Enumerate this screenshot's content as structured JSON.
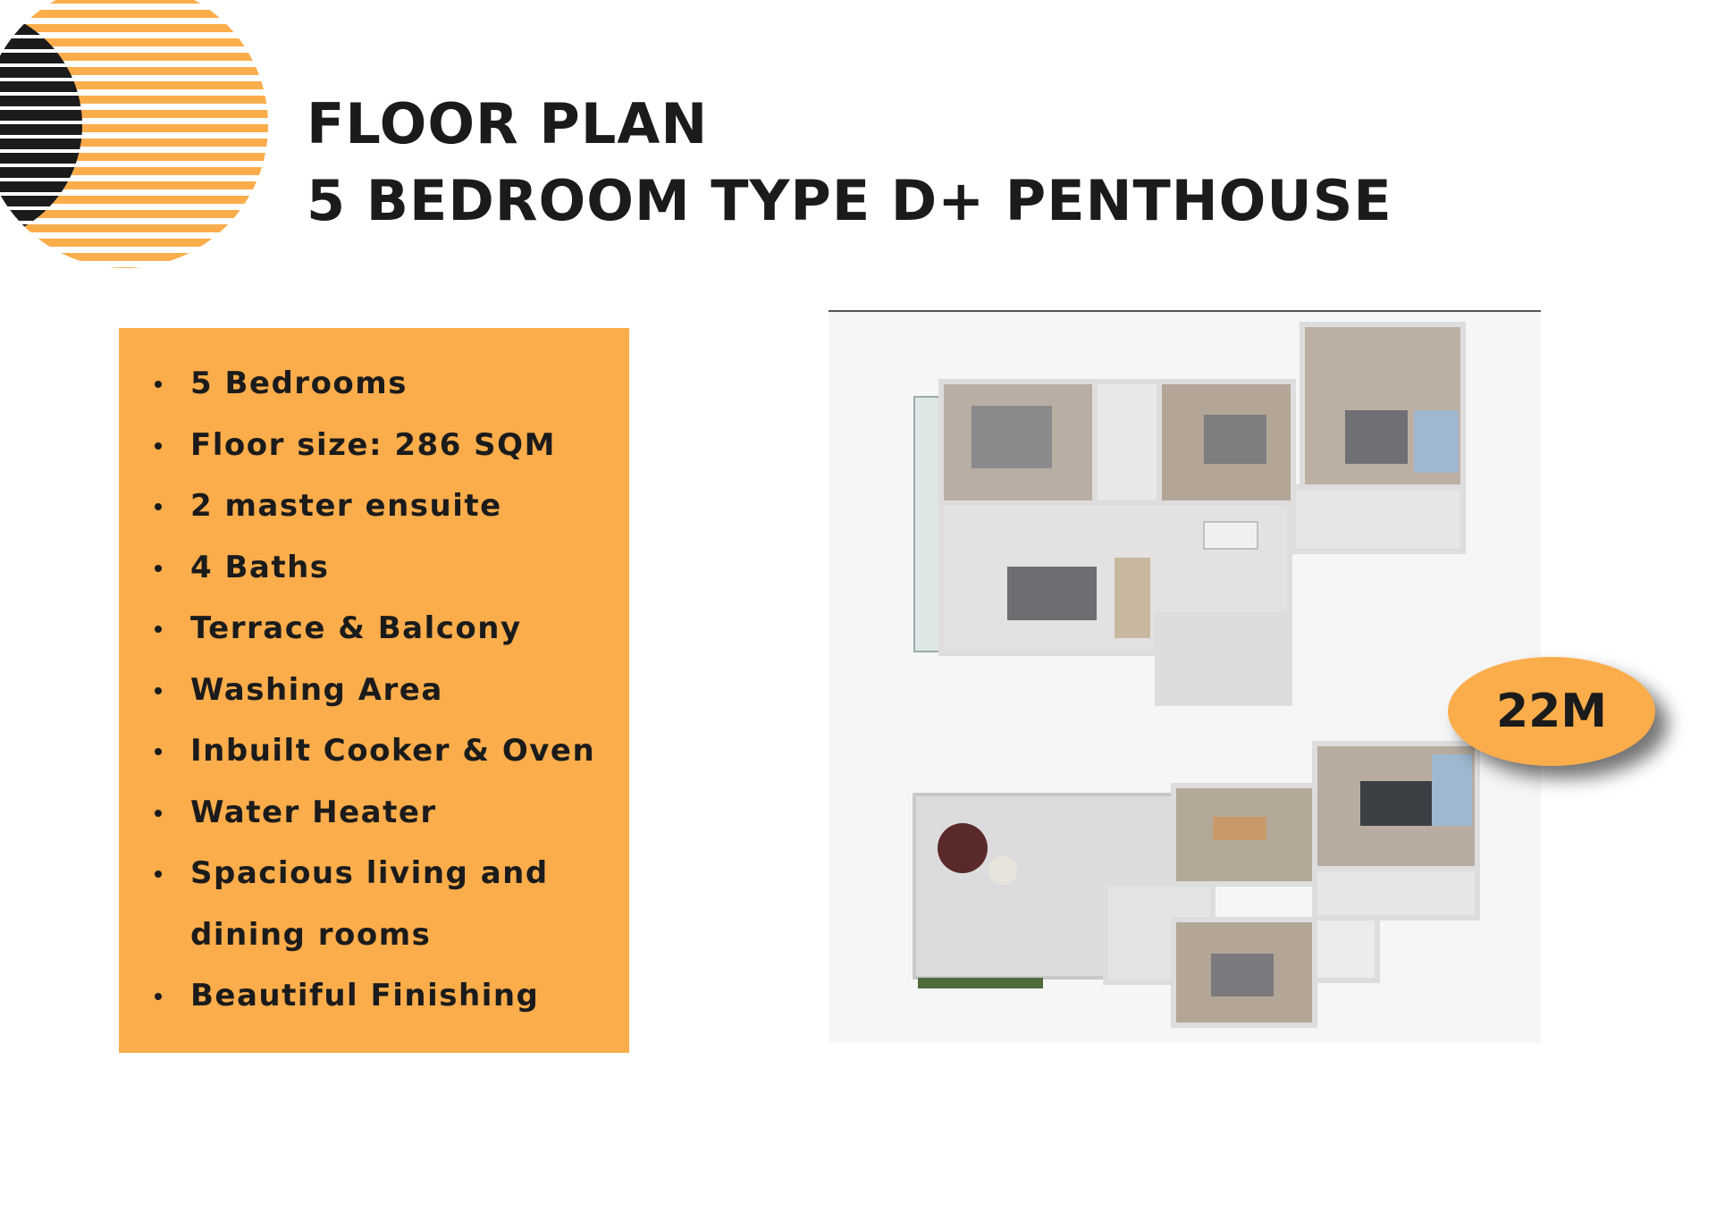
{
  "header": {
    "title_line1": "FLOOR PLAN",
    "title_line2": "5 BEDROOM TYPE D+ PENTHOUSE"
  },
  "features": [
    "5 Bedrooms",
    "Floor size: 286 SQM",
    "2 master ensuite",
    "4 Baths",
    "Terrace & Balcony",
    "Washing Area",
    "Inbuilt Cooker & Oven",
    "Water Heater",
    "Spacious living and dining rooms",
    "Beautiful Finishing"
  ],
  "price": "22M",
  "colors": {
    "accent": "#fbad4b",
    "text": "#1b1b1b",
    "logo_dark": "#1b1b1b"
  },
  "icons": {
    "logo": "striped-sun-logo"
  }
}
